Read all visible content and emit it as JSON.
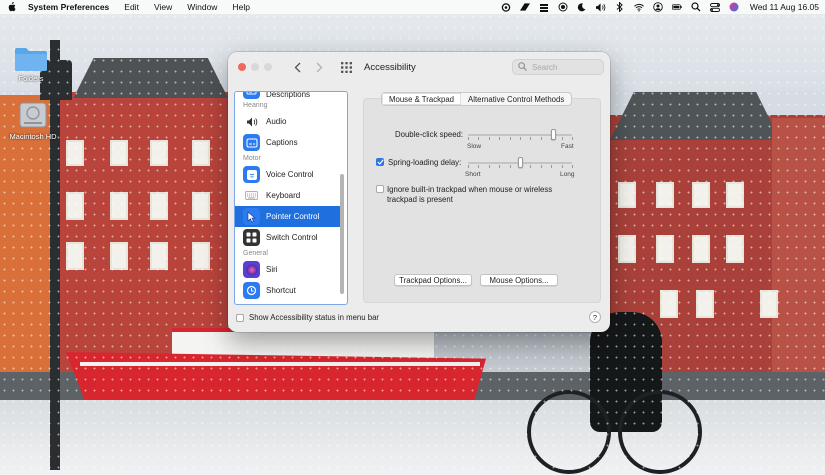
{
  "menubar": {
    "app_name": "System Preferences",
    "menus": [
      "Edit",
      "View",
      "Window",
      "Help"
    ],
    "clock": "Wed 11 Aug  16.05",
    "status_icons": [
      "creative-cloud-icon",
      "brand-icon",
      "stack-icon",
      "record-icon",
      "moon-icon",
      "volume-icon",
      "bluetooth-icon",
      "wifi-icon",
      "user-icon",
      "battery-icon",
      "search-icon",
      "control-center-icon",
      "siri-icon"
    ]
  },
  "desktop": {
    "icons": [
      {
        "label": "Folders",
        "icon": "folder-icon"
      },
      {
        "label": "Macintosh HD",
        "icon": "hard-disk-icon"
      }
    ]
  },
  "window": {
    "title": "Accessibility",
    "search_placeholder": "Search",
    "sidebar": {
      "items": [
        {
          "kind": "item",
          "label": "Descriptions",
          "icon": "descriptions-icon",
          "color": "#2d7bf0"
        },
        {
          "kind": "header",
          "label": "Hearing"
        },
        {
          "kind": "item",
          "label": "Audio",
          "icon": "audio-icon",
          "color": "#e7e7e7"
        },
        {
          "kind": "item",
          "label": "Captions",
          "icon": "captions-icon",
          "color": "#2d7bf0"
        },
        {
          "kind": "header",
          "label": "Motor"
        },
        {
          "kind": "item",
          "label": "Voice Control",
          "icon": "voice-control-icon",
          "color": "#2d7bf0"
        },
        {
          "kind": "item",
          "label": "Keyboard",
          "icon": "keyboard-icon",
          "color": "#e7e7e7"
        },
        {
          "kind": "item",
          "label": "Pointer Control",
          "icon": "pointer-control-icon",
          "color": "#2d7bf0",
          "selected": true
        },
        {
          "kind": "item",
          "label": "Switch Control",
          "icon": "switch-control-icon",
          "color": "#333333"
        },
        {
          "kind": "header",
          "label": "General"
        },
        {
          "kind": "item",
          "label": "Siri",
          "icon": "siri-icon",
          "color": "#5b3fd1"
        },
        {
          "kind": "item",
          "label": "Shortcut",
          "icon": "shortcut-icon",
          "color": "#2d7bf0"
        }
      ]
    },
    "tabs": [
      {
        "label": "Mouse & Trackpad",
        "active": true
      },
      {
        "label": "Alternative Control Methods",
        "active": false
      }
    ],
    "double_click": {
      "label": "Double-click speed:",
      "min_label": "Slow",
      "max_label": "Fast",
      "level": 0.82
    },
    "spring_loading": {
      "label": "Spring-loading delay:",
      "checked": true,
      "min_label": "Short",
      "max_label": "Long",
      "level": 0.5
    },
    "ignore_trackpad": {
      "label_line1": "Ignore built-in trackpad when mouse or wireless",
      "label_line2": "trackpad is present",
      "checked": false
    },
    "trackpad_options": "Trackpad Options...",
    "mouse_options": "Mouse Options...",
    "footer": {
      "label": "Show Accessibility status in menu bar",
      "checked": false
    },
    "help": "?"
  }
}
